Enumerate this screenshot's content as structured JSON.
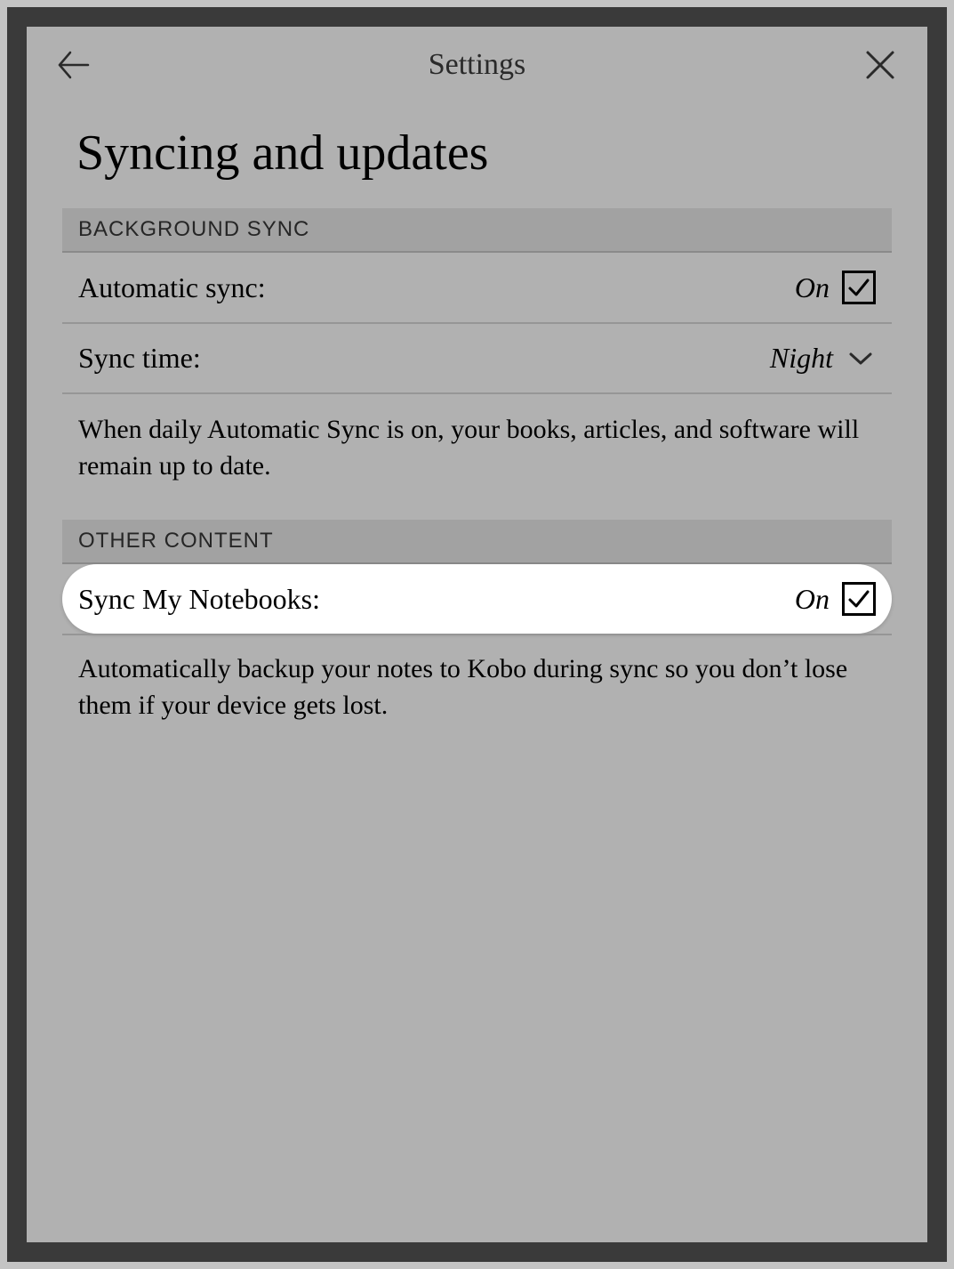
{
  "header": {
    "title": "Settings"
  },
  "page": {
    "title": "Syncing and updates"
  },
  "sections": {
    "background_sync": {
      "heading": "BACKGROUND SYNC",
      "auto_sync": {
        "label": "Automatic sync:",
        "value": "On"
      },
      "sync_time": {
        "label": "Sync time:",
        "value": "Night"
      },
      "description": "When daily Automatic Sync is on, your books, articles, and software will remain up to date."
    },
    "other_content": {
      "heading": "OTHER CONTENT",
      "sync_notebooks": {
        "label": "Sync My Notebooks:",
        "value": "On"
      },
      "description": "Automatically backup your notes to Kobo during sync so you don’t lose them if your device gets lost."
    }
  }
}
